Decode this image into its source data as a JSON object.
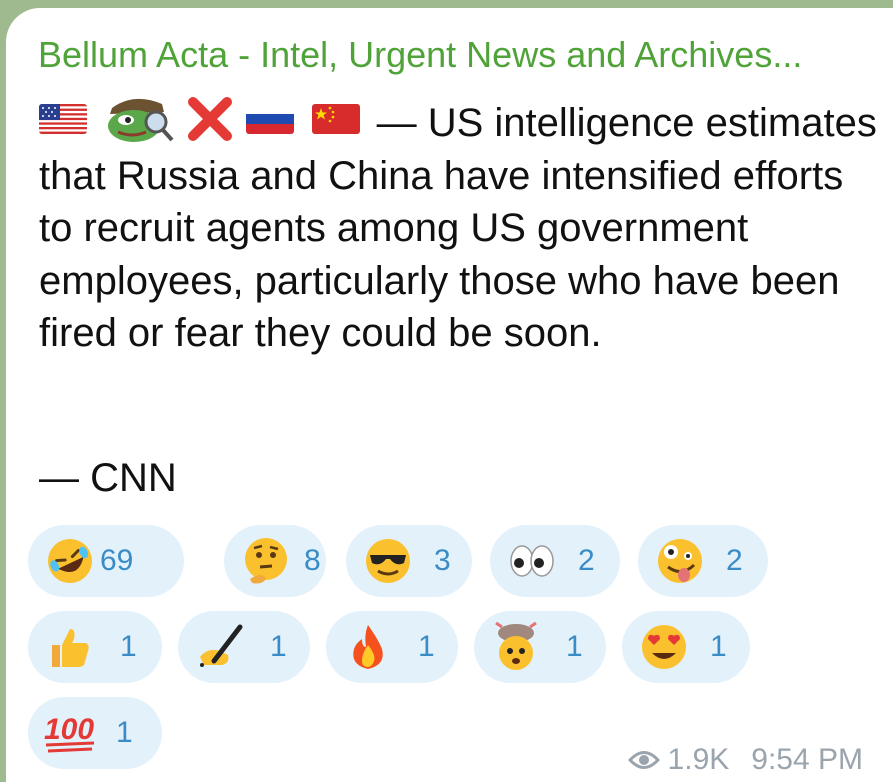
{
  "message": {
    "channel": "Bellum Acta - Intel, Urgent News and Archives...",
    "body": "— US intelligence estimates that Russia and China have intensified efforts to recruit agents among US government employees, particularly those who have been fired or fear they could be soon.",
    "source": "— CNN",
    "leading_icons": [
      "us-flag-icon",
      "pepe-detective-icon",
      "red-x-icon",
      "russia-flag-icon",
      "china-flag-icon"
    ]
  },
  "reactions": [
    {
      "emoji": "rolling-laughing-icon",
      "count": "69"
    },
    {
      "emoji": "thinking-face-icon",
      "count": "8"
    },
    {
      "emoji": "sunglasses-face-icon",
      "count": "3"
    },
    {
      "emoji": "eyes-icon",
      "count": "2"
    },
    {
      "emoji": "zany-face-icon",
      "count": "2"
    },
    {
      "emoji": "thumbs-up-icon",
      "count": "1"
    },
    {
      "emoji": "writing-hand-icon",
      "count": "1"
    },
    {
      "emoji": "fire-icon",
      "count": "1"
    },
    {
      "emoji": "exploding-head-icon",
      "count": "1"
    },
    {
      "emoji": "heart-eyes-icon",
      "count": "1"
    },
    {
      "emoji": "hundred-points-icon",
      "count": "1"
    }
  ],
  "footer": {
    "views": "1.9K",
    "time": "9:54 PM"
  },
  "colors": {
    "channel": "#4fa338",
    "reaction_bg": "#e3f1fb",
    "reaction_count": "#3a8cc6",
    "meta": "#9aa4ad"
  }
}
